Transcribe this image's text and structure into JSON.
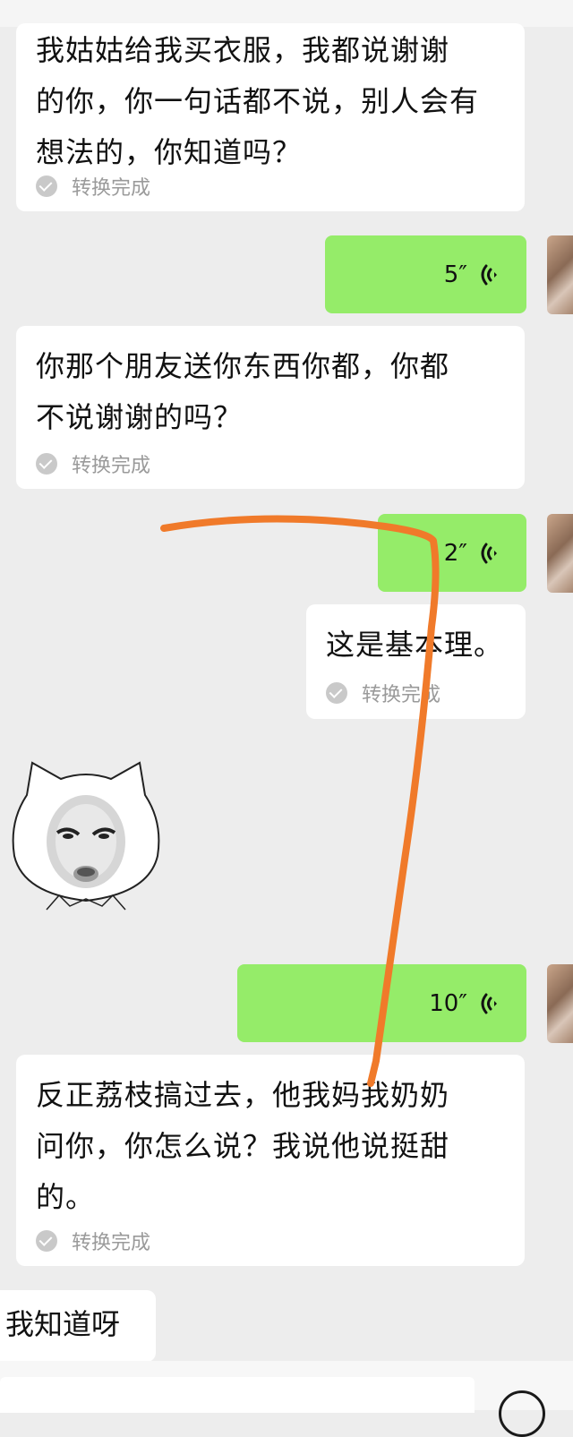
{
  "messages": {
    "m1": {
      "text": "我姑姑给我买衣服，我都说谢谢\n的你，你一句话都不说，别人会有\n想法的，你知道吗？",
      "status": "转换完成"
    },
    "v1": {
      "duration": "5″"
    },
    "m2": {
      "text": "你那个朋友送你东西你都，你都\n不说谢谢的吗？",
      "status": "转换完成"
    },
    "v2": {
      "duration": "2″"
    },
    "m3": {
      "text": "这是基本理。",
      "status": "转换完成"
    },
    "v3": {
      "duration": "10″"
    },
    "m4": {
      "text": "反正荔枝搞过去，他我妈我奶奶\n问你，你怎么说？我说他说挺甜\n的。",
      "status": "转换完成"
    },
    "m5": {
      "text": "我知道呀"
    }
  },
  "icons": {
    "voice_wave": "voice-wave-icon",
    "converted_check": "check-circle-icon",
    "sticker": "cat-face-sticker",
    "plus": "plus-circle-icon"
  },
  "colors": {
    "background": "#ededed",
    "bubble_incoming": "#ffffff",
    "bubble_outgoing": "#95ec69",
    "status_text": "#9a9a9a",
    "scribble": "#f07a2a"
  }
}
